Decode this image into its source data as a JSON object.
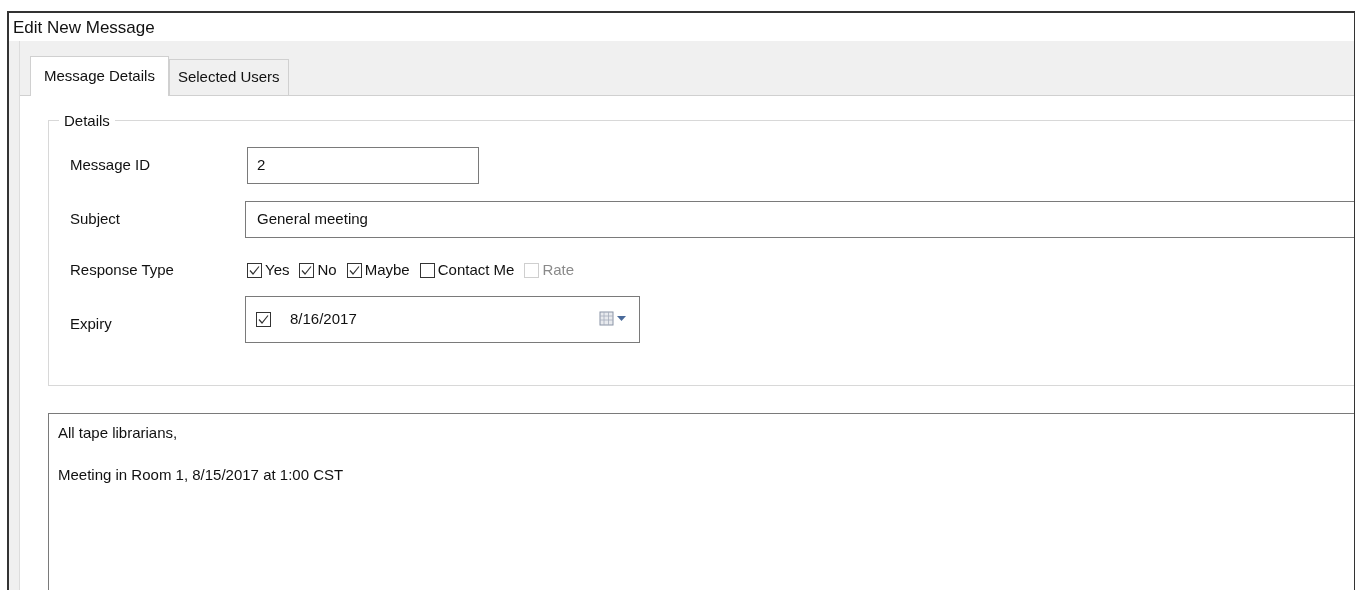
{
  "window": {
    "title": "Edit New Message"
  },
  "tabs": [
    {
      "label": "Message Details",
      "selected": true
    },
    {
      "label": "Selected Users",
      "selected": false
    }
  ],
  "details": {
    "legend": "Details",
    "message_id": {
      "label": "Message ID",
      "value": "2"
    },
    "subject": {
      "label": "Subject",
      "value": "General meeting"
    },
    "response_type": {
      "label": "Response Type",
      "options": [
        {
          "label": "Yes",
          "checked": true,
          "disabled": false
        },
        {
          "label": "No",
          "checked": true,
          "disabled": false
        },
        {
          "label": "Maybe",
          "checked": true,
          "disabled": false
        },
        {
          "label": "Contact Me",
          "checked": false,
          "disabled": false
        },
        {
          "label": "Rate",
          "checked": false,
          "disabled": true
        }
      ]
    },
    "expiry": {
      "label": "Expiry",
      "checked": true,
      "value": "8/16/2017"
    }
  },
  "message_body": {
    "lines": [
      "All tape librarians,",
      "Meeting in Room 1, 8/15/2017 at 1:00 CST"
    ]
  }
}
